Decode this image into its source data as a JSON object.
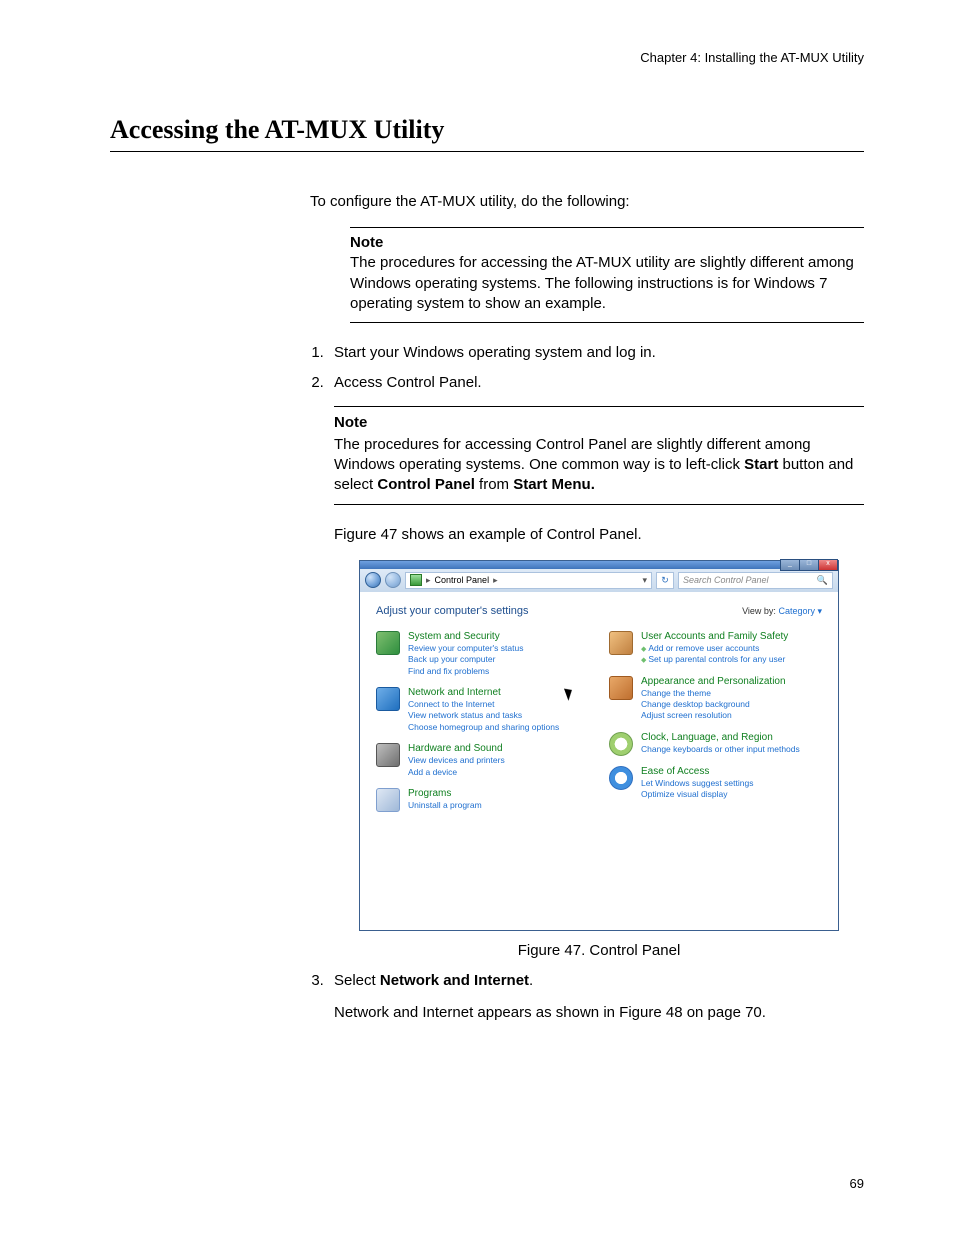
{
  "chapter_header": "Chapter 4: Installing the AT-MUX Utility",
  "section_title": "Accessing the AT-MUX Utility",
  "intro": "To configure the AT-MUX utility, do the following:",
  "note1": {
    "label": "Note",
    "body": "The procedures for accessing the AT-MUX utility are slightly different among Windows operating systems. The following instructions is for Windows 7 operating system to show an example."
  },
  "step1": "Start your Windows operating system and log in.",
  "step2": "Access Control Panel.",
  "note2": {
    "label": "Note",
    "body_pre": "The procedures for accessing Control Panel are slightly different among Windows operating systems. One common way is to left-click ",
    "bold1": "Start",
    "mid1": " button and select ",
    "bold2": "Control Panel",
    "mid2": " from ",
    "bold3": "Start Menu."
  },
  "figure_intro": "Figure 47 shows an example of Control Panel.",
  "figure_caption": "Figure 47. Control Panel",
  "step3_pre": "Select ",
  "step3_bold": "Network and Internet",
  "step3_post": ".",
  "step3_result": "Network and Internet appears as shown in Figure 48 on page 70.",
  "page_number": "69",
  "cp": {
    "title_min": "_",
    "title_max": "□",
    "title_close": "x",
    "breadcrumb_label": "Control Panel",
    "breadcrumb_arrow1": "▸",
    "breadcrumb_arrow2": "▸",
    "address_dd": "▾",
    "refresh": "↻",
    "search_placeholder": "Search Control Panel",
    "search_icon": "🔍",
    "adjust": "Adjust your computer's settings",
    "viewby_label": "View by:",
    "viewby_value": "Category ▾",
    "left": [
      {
        "head": "System and Security",
        "subs": [
          "Review your computer's status",
          "Back up your computer",
          "Find and fix problems"
        ]
      },
      {
        "head": "Network and Internet",
        "subs": [
          "Connect to the Internet",
          "View network status and tasks",
          "Choose homegroup and sharing options"
        ]
      },
      {
        "head": "Hardware and Sound",
        "subs": [
          "View devices and printers",
          "Add a device"
        ]
      },
      {
        "head": "Programs",
        "subs": [
          "Uninstall a program"
        ]
      }
    ],
    "right": [
      {
        "head": "User Accounts and Family Safety",
        "subs": [
          "Add or remove user accounts",
          "Set up parental controls for any user"
        ],
        "withicon": true
      },
      {
        "head": "Appearance and Personalization",
        "subs": [
          "Change the theme",
          "Change desktop background",
          "Adjust screen resolution"
        ]
      },
      {
        "head": "Clock, Language, and Region",
        "subs": [
          "Change keyboards or other input methods"
        ]
      },
      {
        "head": "Ease of Access",
        "subs": [
          "Let Windows suggest settings",
          "Optimize visual display"
        ]
      }
    ]
  }
}
